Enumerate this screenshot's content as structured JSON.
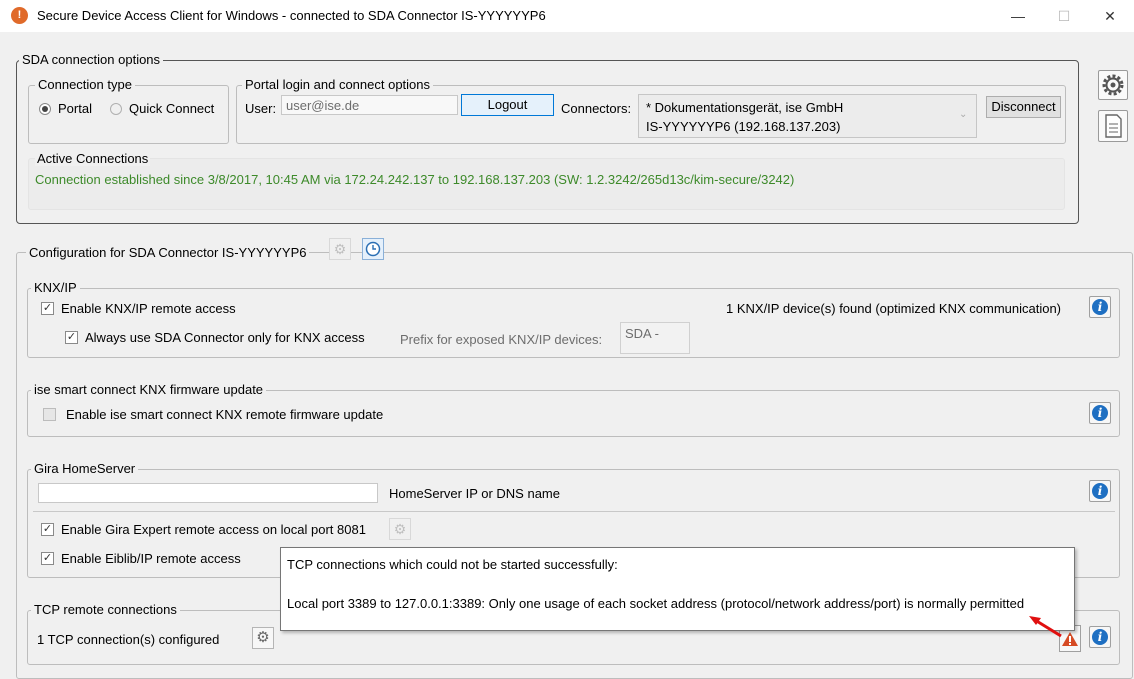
{
  "window": {
    "title": "Secure Device Access Client for Windows - connected to SDA Connector IS-YYYYYYP6",
    "minimize": "—",
    "maximize": "☐",
    "close": "✕"
  },
  "sda": {
    "legend": "SDA connection options",
    "conn_type": {
      "legend": "Connection type",
      "portal": "Portal",
      "quick": "Quick Connect"
    },
    "portal": {
      "legend": "Portal login and connect options",
      "user_label": "User:",
      "user_value": "user@ise.de",
      "logout": "Logout",
      "connectors_label": "Connectors:",
      "connector_line1": "* Dokumentationsgerät, ise GmbH",
      "connector_line2": "IS-YYYYYYP6 (192.168.137.203)",
      "disconnect": "Disconnect"
    },
    "active": {
      "legend": "Active Connections",
      "text": "Connection established since 3/8/2017, 10:45 AM via 172.24.242.137 to 192.168.137.203 (SW: 1.2.3242/265d13c/kim-secure/3242)",
      "color": "#3d8a2a"
    }
  },
  "config": {
    "legend": "Configuration for SDA Connector IS-YYYYYYP6",
    "knx": {
      "legend": "KNX/IP",
      "enable": "Enable KNX/IP remote access",
      "always": "Always use SDA Connector only for KNX access",
      "prefix_label": "Prefix for exposed KNX/IP devices:",
      "prefix_value": "SDA -",
      "found": "1 KNX/IP device(s) found (optimized KNX communication)"
    },
    "ise": {
      "legend": "ise smart connect KNX firmware update",
      "enable": "Enable ise smart connect KNX remote firmware update"
    },
    "gira": {
      "legend": "Gira HomeServer",
      "hs_label": "HomeServer IP or DNS name",
      "expert": "Enable Gira Expert remote access on local port 8081",
      "eiblib": "Enable Eiblib/IP remote access"
    },
    "tcp": {
      "legend": "TCP remote connections",
      "count": "1 TCP connection(s) configured"
    }
  },
  "tooltip": {
    "line1": "TCP connections which could not be started successfully:",
    "line2": "Local port 3389 to 127.0.0.1:3389: Only one usage of each socket address (protocol/network address/port) is normally permitted"
  },
  "icons": [
    "app-icon",
    "gear-icon",
    "document-icon",
    "clock-icon",
    "info-icon",
    "warning-icon",
    "arrow-icon"
  ],
  "colors": {
    "accent": "#1e6fc2",
    "warning": "#d64b24",
    "arrow": "#e01010"
  }
}
